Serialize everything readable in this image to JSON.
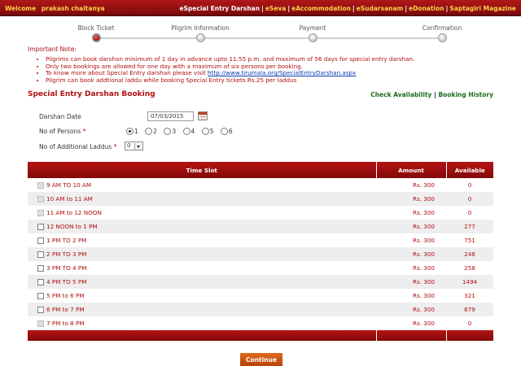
{
  "header": {
    "welcome_label": "Welcome",
    "user_name": "prakash chaitanya",
    "nav": [
      {
        "label": "eSpecial Entry Darshan",
        "active": true
      },
      {
        "label": "eSeva",
        "active": false
      },
      {
        "label": "eAccommodation",
        "active": false
      },
      {
        "label": "eSudarsanam",
        "active": false
      },
      {
        "label": "eDonation",
        "active": false
      },
      {
        "label": "Saptagiri Magazine",
        "active": false
      }
    ],
    "separator": "|"
  },
  "steps": [
    {
      "label": "Block Ticket",
      "active": true
    },
    {
      "label": "Pilgrim Information",
      "active": false
    },
    {
      "label": "Payment",
      "active": false
    },
    {
      "label": "Confirmation",
      "active": false
    }
  ],
  "notes": {
    "title": "Important Note:",
    "items": [
      "Pilgrims can book darshan minimum of 1 day in advance upto 11:55 p.m. and maximum of 56 days for special entry darshan.",
      "Only two bookings are allowed for one day with a maximum of six persons per booking.",
      "Pilgrim can book addtional laddu while booking Special Entry tickets Rs.25 per laddus"
    ],
    "link_prefix": "To know more about Special Entry darshan please visit ",
    "link_text": "http://www.tirumala.org/SpecialEntryDarshan.aspx"
  },
  "section": {
    "title": "Special Entry Darshan Booking",
    "check_availability": "Check Availability",
    "link_sep": "|",
    "booking_history": "Booking History"
  },
  "form": {
    "date_label": "Darshan Date",
    "date_value": "07/03/2015",
    "persons_label": "No of Persons",
    "required_mark": "*",
    "persons_options": [
      "1",
      "2",
      "3",
      "4",
      "5",
      "6"
    ],
    "persons_selected": "1",
    "laddus_label": "No of Additional Laddus",
    "laddus_value": "0"
  },
  "table": {
    "headers": {
      "slot": "Time Slot",
      "amount": "Amount",
      "available": "Available"
    },
    "rows": [
      {
        "slot": "9 AM TO 10 AM",
        "amount": "Rs. 300",
        "available": "0",
        "disabled": true
      },
      {
        "slot": "10 AM to 11 AM",
        "amount": "Rs. 300",
        "available": "0",
        "disabled": true
      },
      {
        "slot": "11 AM to 12 NOON",
        "amount": "Rs. 300",
        "available": "0",
        "disabled": true
      },
      {
        "slot": "12 NOON to 1 PM",
        "amount": "Rs. 300",
        "available": "277",
        "disabled": false
      },
      {
        "slot": "1 PM TO 2 PM",
        "amount": "Rs. 300",
        "available": "751",
        "disabled": false
      },
      {
        "slot": "2 PM TO 3 PM",
        "amount": "Rs. 300",
        "available": "248",
        "disabled": false
      },
      {
        "slot": "3 PM TO 4 PM",
        "amount": "Rs. 300",
        "available": "258",
        "disabled": false
      },
      {
        "slot": "4 PM TO 5 PM",
        "amount": "Rs. 300",
        "available": "1494",
        "disabled": false
      },
      {
        "slot": "5 PM to 6 PM",
        "amount": "Rs. 300",
        "available": "321",
        "disabled": false
      },
      {
        "slot": "6 PM to 7 PM",
        "amount": "Rs. 300",
        "available": "679",
        "disabled": false
      },
      {
        "slot": "7 PM to 8 PM",
        "amount": "Rs. 300",
        "available": "0",
        "disabled": true
      }
    ]
  },
  "continue_label": "Continue"
}
